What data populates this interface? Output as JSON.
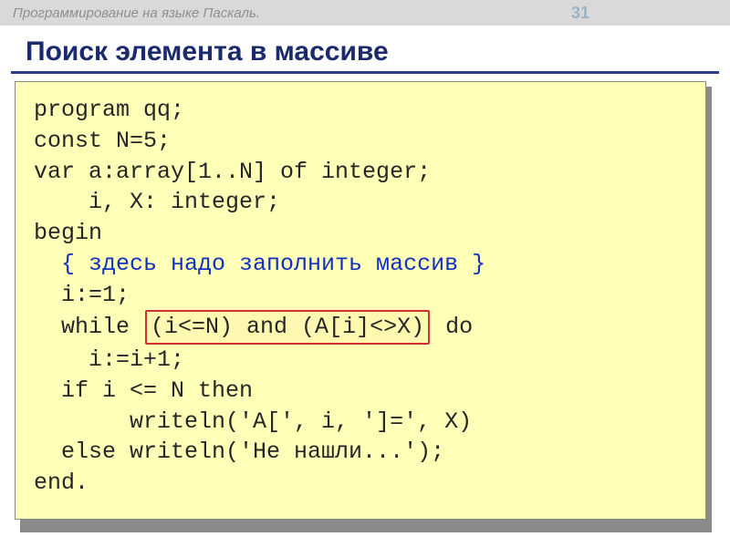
{
  "header": {
    "course": "Программирование на языке Паскаль.",
    "page_number": "31"
  },
  "slide": {
    "title": "Поиск элемента в массиве"
  },
  "code": {
    "l1": "program qq;",
    "l2": "const N=5;",
    "l3": "var a:array[1..N] of integer;",
    "l4": "    i, X: integer;",
    "l5": "begin",
    "comment": "  { здесь надо заполнить массив }",
    "l7": "  i:=1;",
    "l8a": "  while ",
    "l8_hl": "(i<=N) and (A[i]<>X)",
    "l8b": " do",
    "l9": "    i:=i+1;",
    "l10": "  if i <= N then",
    "l11": "       writeln('A[', i, ']=', X)",
    "l12": "  else writeln('Не нашли...');",
    "l13": "end."
  }
}
